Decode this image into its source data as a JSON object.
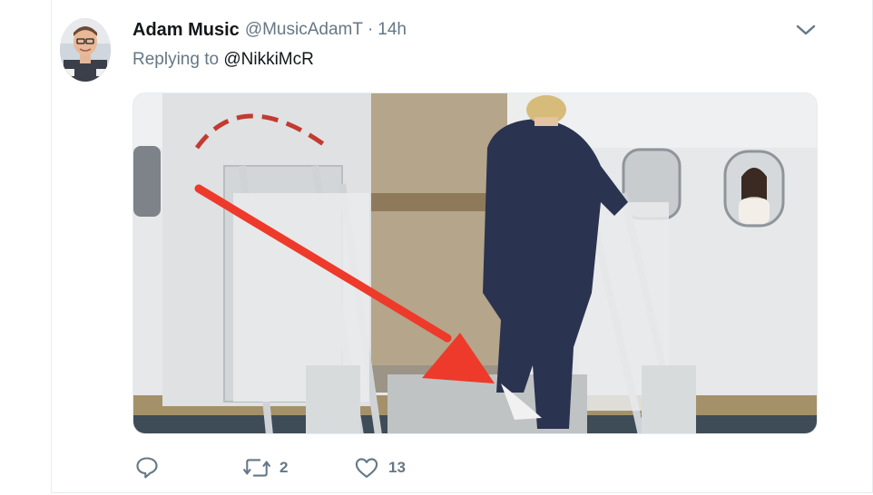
{
  "tweet": {
    "author_name": "Adam Music",
    "author_handle": "@MusicAdamT",
    "separator": "·",
    "time": "14h",
    "replying_prefix": "Replying to",
    "replying_to": "@NikkiMcR"
  },
  "actions": {
    "reply_count": "",
    "retweet_count": "2",
    "like_count": "13"
  },
  "icons": {
    "caret": "chevron-down-icon",
    "reply": "reply-icon",
    "retweet": "retweet-icon",
    "like": "heart-icon"
  },
  "colors": {
    "text_primary": "#14171a",
    "text_secondary": "#657786",
    "arrow_red": "#ee3a2a",
    "suit_navy": "#2a3350"
  }
}
